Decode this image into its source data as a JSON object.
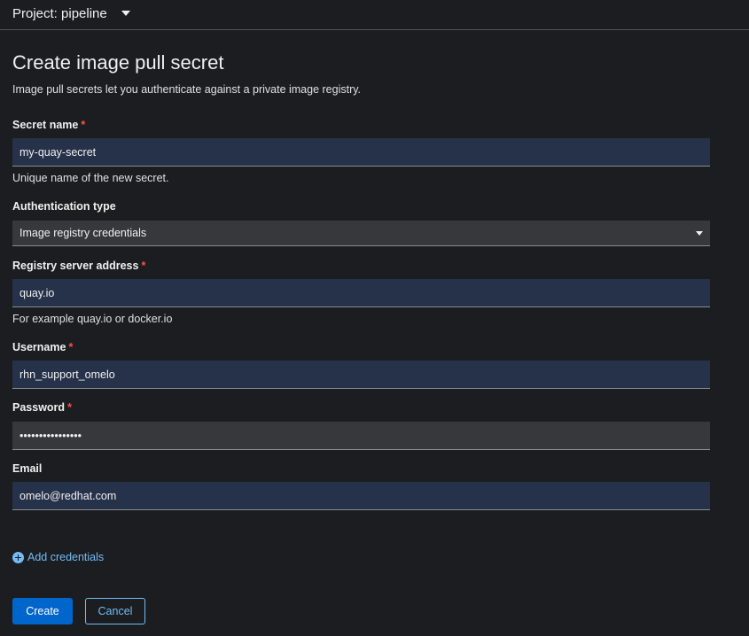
{
  "project": {
    "label": "Project: pipeline"
  },
  "page": {
    "title": "Create image pull secret",
    "subtitle": "Image pull secrets let you authenticate against a private image registry."
  },
  "form": {
    "secret_name": {
      "label": "Secret name",
      "required_mark": "*",
      "value": "my-quay-secret",
      "helper": "Unique name of the new secret."
    },
    "auth_type": {
      "label": "Authentication type",
      "value": "Image registry credentials"
    },
    "registry": {
      "label": "Registry server address",
      "required_mark": "*",
      "value": "quay.io",
      "helper": "For example quay.io or docker.io"
    },
    "username": {
      "label": "Username",
      "required_mark": "*",
      "value": "rhn_support_omelo"
    },
    "password": {
      "label": "Password",
      "required_mark": "*",
      "value": "••••••••••••••••"
    },
    "email": {
      "label": "Email",
      "value": "omelo@redhat.com"
    },
    "add_credentials_label": "Add credentials"
  },
  "actions": {
    "create_label": "Create",
    "cancel_label": "Cancel"
  },
  "colors": {
    "background": "#1b1d21",
    "input_bg": "#26324a",
    "select_bg": "#36383c",
    "primary": "#0066cc",
    "link": "#73bcf7",
    "required": "#fe5142"
  },
  "icons": {
    "project_caret": "caret-down-icon",
    "select_caret": "caret-down-icon",
    "add": "plus-circle-icon"
  }
}
